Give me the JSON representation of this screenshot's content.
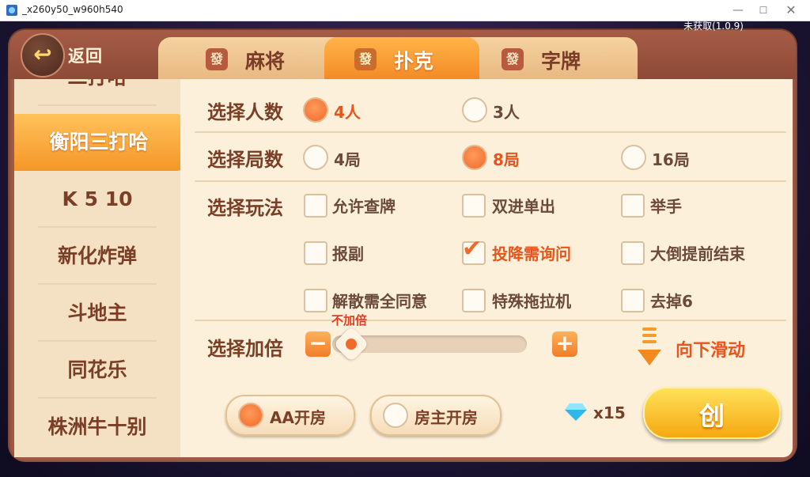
{
  "window": {
    "title": "_x260y50_w960h540",
    "version": "未获取(1.0.9)"
  },
  "header": {
    "back_label": "返回",
    "tabs": [
      {
        "icon_text": "發",
        "label": "麻将",
        "active": false
      },
      {
        "icon_text": "發",
        "label": "扑克",
        "active": true
      },
      {
        "icon_text": "發",
        "label": "字牌",
        "active": false
      }
    ]
  },
  "sidebar": {
    "items": [
      "二打哈",
      "衡阳三打哈",
      "K 5 10",
      "新化炸弹",
      "斗地主",
      "同花乐",
      "株洲牛十别"
    ],
    "selected": "衡阳三打哈"
  },
  "options": {
    "players": {
      "label": "选择人数",
      "choices": [
        "4人",
        "3人"
      ],
      "selected": "4人"
    },
    "rounds": {
      "label": "选择局数",
      "choices": [
        "4局",
        "8局",
        "16局"
      ],
      "selected": "8局"
    },
    "rules": {
      "label": "选择玩法",
      "items": [
        {
          "text": "允许查牌",
          "checked": false
        },
        {
          "text": "双进单出",
          "checked": false
        },
        {
          "text": "举手",
          "checked": false
        },
        {
          "text": "报副",
          "checked": false
        },
        {
          "text": "投降需询问",
          "checked": true
        },
        {
          "text": "大倒提前结束",
          "checked": false
        },
        {
          "text": "解散需全同意",
          "checked": false
        },
        {
          "text": "特殊拖拉机",
          "checked": false
        },
        {
          "text": "去掉6",
          "checked": false
        }
      ]
    },
    "multiplier": {
      "label": "选择加倍",
      "value_text": "不加倍",
      "level": 0
    }
  },
  "scroll_hint": "向下滑动",
  "footer": {
    "room_aa": "AA开房",
    "room_host": "房主开房",
    "room_selected": "AA开房",
    "diamond_count": "x15",
    "create_label": "创"
  },
  "colors": {
    "accent": "#f06a2a",
    "brand_brown": "#7b3f27",
    "panel": "#fdf0da"
  }
}
